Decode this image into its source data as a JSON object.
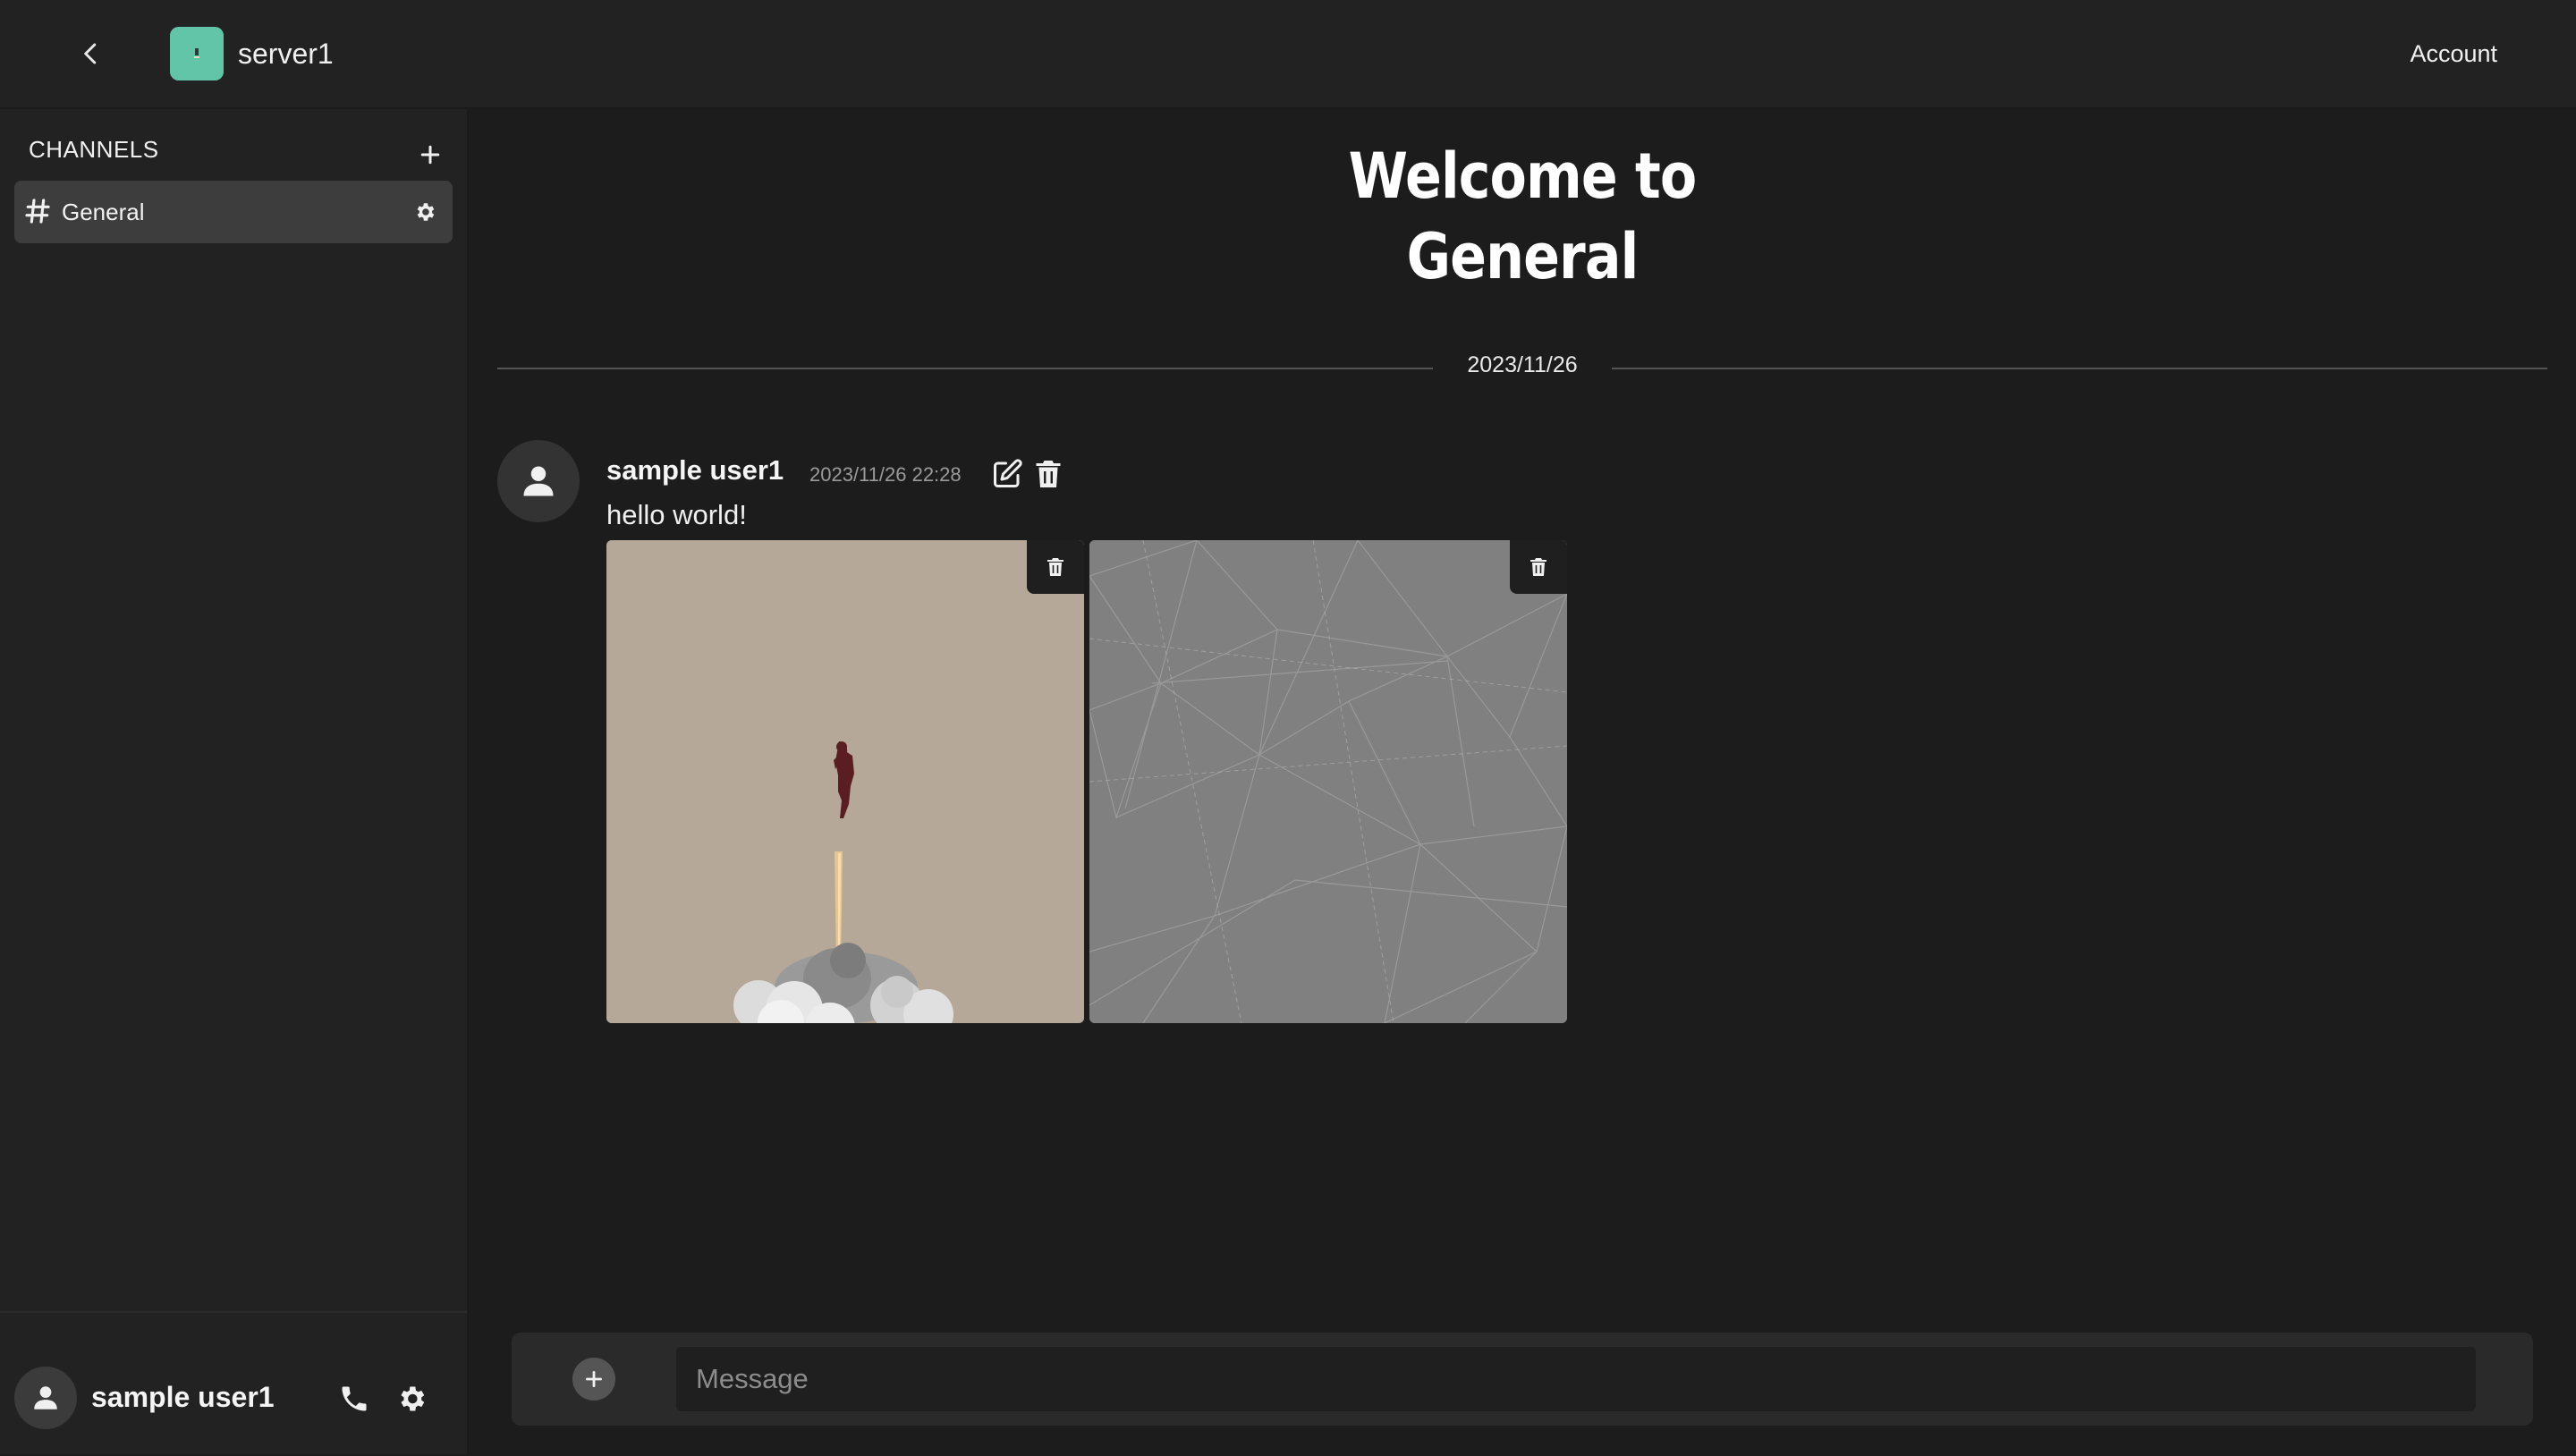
{
  "header": {
    "server_name": "server1",
    "account_label": "Account"
  },
  "sidebar": {
    "channels_header": "CHANNELS",
    "channels": [
      {
        "label": "General",
        "selected": true
      }
    ],
    "user": {
      "name": "sample user1"
    }
  },
  "main": {
    "welcome_line1": "Welcome to",
    "welcome_line2": "General",
    "date_divider": "2023/11/26",
    "messages": [
      {
        "author": "sample user1",
        "timestamp": "2023/11/26 22:28",
        "text": "hello world!",
        "attachments": [
          {
            "subject": "flying figure with rocket exhaust and smoke cloud on beige background"
          },
          {
            "subject": "gray abstract polygonal line texture"
          }
        ]
      }
    ]
  },
  "composer": {
    "placeholder": "Message"
  },
  "colors": {
    "app_background": "#1c1c1c",
    "panel_background": "#222222",
    "selected_channel": "#3d3d3d",
    "server_icon": "#62c5a8",
    "composer_background": "#2a2a2a"
  },
  "icons": [
    "chevron-left-icon",
    "hash-icon",
    "plus-icon",
    "gear-icon",
    "user-icon",
    "phone-icon",
    "edit-icon",
    "trash-icon"
  ]
}
